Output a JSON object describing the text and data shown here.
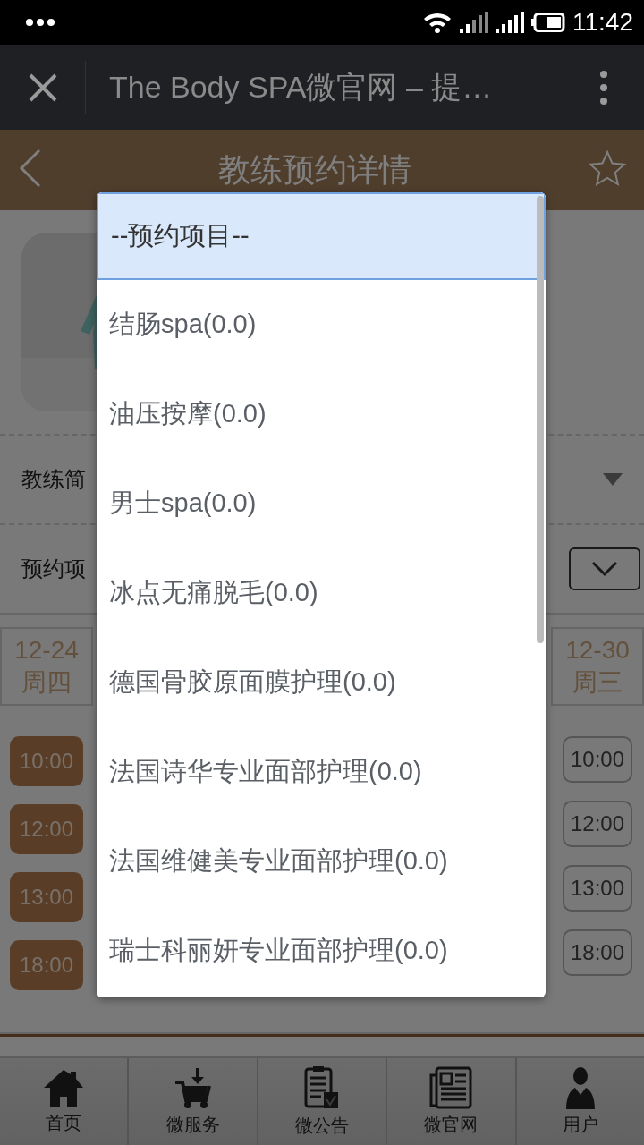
{
  "status_bar": {
    "time": "11:42"
  },
  "browser_bar": {
    "title": "The Body SPA微官网 – 提…"
  },
  "header": {
    "title": "教练预约详情"
  },
  "fields": [
    {
      "label": "教练简",
      "kind": "expand"
    },
    {
      "label": "预约项",
      "kind": "select"
    }
  ],
  "schedule": {
    "columns": [
      {
        "date": "12-24",
        "weekday": "周四",
        "slots": [
          {
            "time": "10:00",
            "booked": true
          },
          {
            "time": "12:00",
            "booked": true
          },
          {
            "time": "13:00",
            "booked": true
          },
          {
            "time": "18:00",
            "booked": true
          }
        ]
      },
      {
        "date": "12-30",
        "weekday": "周三",
        "slots": [
          {
            "time": "10:00",
            "booked": false
          },
          {
            "time": "12:00",
            "booked": false
          },
          {
            "time": "13:00",
            "booked": false
          },
          {
            "time": "18:00",
            "booked": false
          }
        ]
      }
    ]
  },
  "dropdown": {
    "options": [
      {
        "label": "--预约项目--",
        "selected": true
      },
      {
        "label": "结肠spa(0.0)",
        "selected": false
      },
      {
        "label": "油压按摩(0.0)",
        "selected": false
      },
      {
        "label": "男士spa(0.0)",
        "selected": false
      },
      {
        "label": "冰点无痛脱毛(0.0)",
        "selected": false
      },
      {
        "label": "德国骨胶原面膜护理(0.0)",
        "selected": false
      },
      {
        "label": "法国诗华专业面部护理(0.0)",
        "selected": false
      },
      {
        "label": "法国维健美专业面部护理(0.0)",
        "selected": false
      },
      {
        "label": "瑞士科丽妍专业面部护理(0.0)",
        "selected": false
      }
    ]
  },
  "bottom_nav": [
    {
      "label": "首页",
      "kind": "home"
    },
    {
      "label": "微服务",
      "kind": "cart"
    },
    {
      "label": "微公告",
      "kind": "notice"
    },
    {
      "label": "微官网",
      "kind": "news"
    },
    {
      "label": "用户",
      "kind": "user"
    }
  ]
}
